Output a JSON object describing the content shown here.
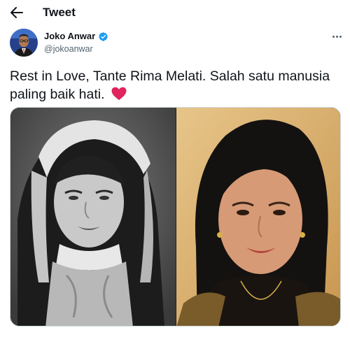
{
  "header": {
    "title": "Tweet",
    "back_icon": "arrow-left-icon"
  },
  "tweet": {
    "author": {
      "name": "Joko Anwar",
      "handle": "@jokoanwar",
      "verified": true,
      "verified_color": "#1d9bf0"
    },
    "text": "Rest in Love, Tante Rima Melati. Salah satu manusia paling baik hati.",
    "emoji": "red-heart",
    "emoji_color": "#e0245e",
    "media": {
      "count": 2
    }
  },
  "colors": {
    "secondary_text": "#536471",
    "primary_text": "#0f1419",
    "accent": "#1d9bf0"
  }
}
